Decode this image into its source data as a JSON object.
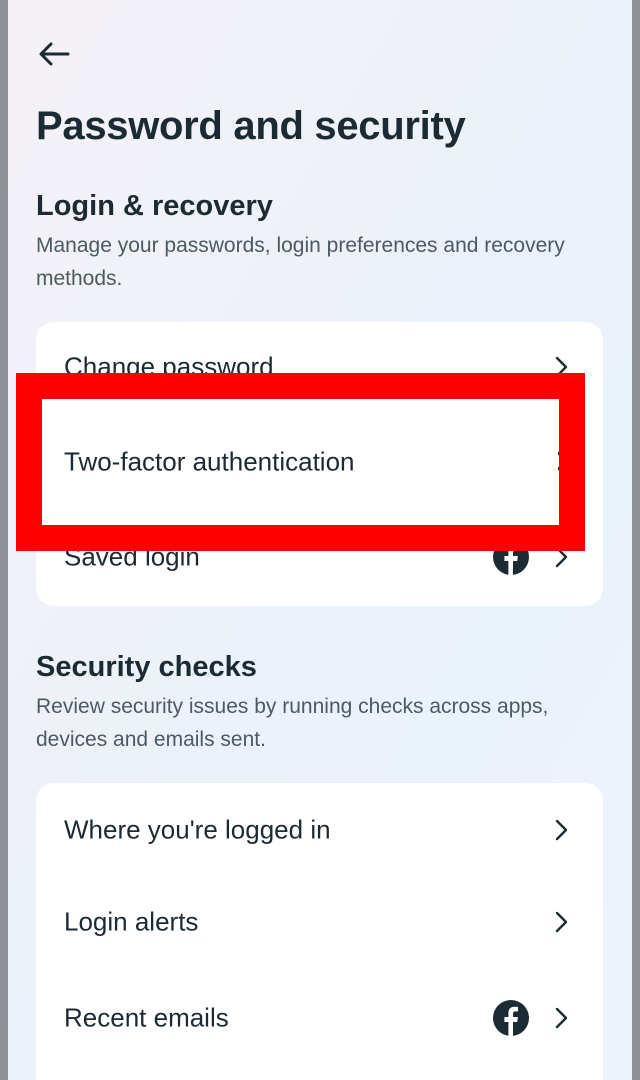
{
  "header": {
    "back_icon": "arrow-left-icon",
    "title": "Password and security"
  },
  "login_recovery": {
    "title": "Login & recovery",
    "description": "Manage your passwords, login preferences and recovery methods.",
    "items": [
      {
        "label": "Change password",
        "icon": "chevron-right-icon"
      },
      {
        "label": "Two-factor authentication",
        "icon": "chevron-right-icon"
      },
      {
        "label": "Saved login",
        "icon": "facebook-icon"
      }
    ]
  },
  "security_checks": {
    "title": "Security checks",
    "description": "Review security issues by running checks across apps, devices and emails sent.",
    "items": [
      {
        "label": "Where you're logged in",
        "icon": "chevron-right-icon"
      },
      {
        "label": "Login alerts",
        "icon": "chevron-right-icon"
      },
      {
        "label": "Recent emails",
        "icon": "facebook-icon"
      }
    ]
  },
  "colors": {
    "text": "#1c2b33",
    "highlight": "#ff0000",
    "facebook": "#1c2b33"
  }
}
